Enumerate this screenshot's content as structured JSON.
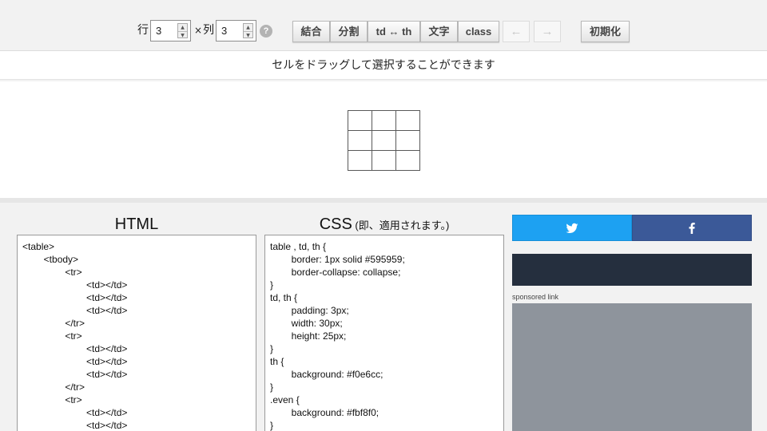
{
  "toolbar": {
    "rows_label": "行",
    "rows_value": "3",
    "times_label": "×",
    "cols_label": "列",
    "cols_value": "3",
    "help_label": "?",
    "buttons": {
      "merge": "結合",
      "split": "分割",
      "td_th": "td ↔ th",
      "text": "文字",
      "class": "class",
      "undo": "←",
      "redo": "→",
      "reset": "初期化"
    }
  },
  "hint": "セルをドラッグして選択することができます",
  "preview": {
    "rows": 3,
    "cols": 3
  },
  "html_pane": {
    "title": "HTML",
    "lines": [
      "<table>",
      "        <tbody>",
      "                <tr>",
      "                        <td></td>",
      "                        <td></td>",
      "                        <td></td>",
      "                </tr>",
      "                <tr>",
      "                        <td></td>",
      "                        <td></td>",
      "                        <td></td>",
      "                </tr>",
      "                <tr>",
      "                        <td></td>",
      "                        <td></td>"
    ]
  },
  "css_pane": {
    "title": "CSS",
    "subtitle": " (即、適用されます。)",
    "lines": [
      "table , td, th {",
      "        border: 1px solid #595959;",
      "        border-collapse: collapse;",
      "}",
      "td, th {",
      "        padding: 3px;",
      "        width: 30px;",
      "        height: 25px;",
      "}",
      "th {",
      "        background: #f0e6cc;",
      "}",
      ".even {",
      "        background: #fbf8f0;",
      "}"
    ]
  },
  "sidebar": {
    "twitter_icon": "twitter-bird-icon",
    "facebook_icon": "facebook-f-icon",
    "sponsored_label": "sponsored link"
  },
  "colors": {
    "twitter": "#1da1f2",
    "facebook": "#3b5998",
    "dark_bar": "#252f3e",
    "ad": "#8e949c"
  }
}
